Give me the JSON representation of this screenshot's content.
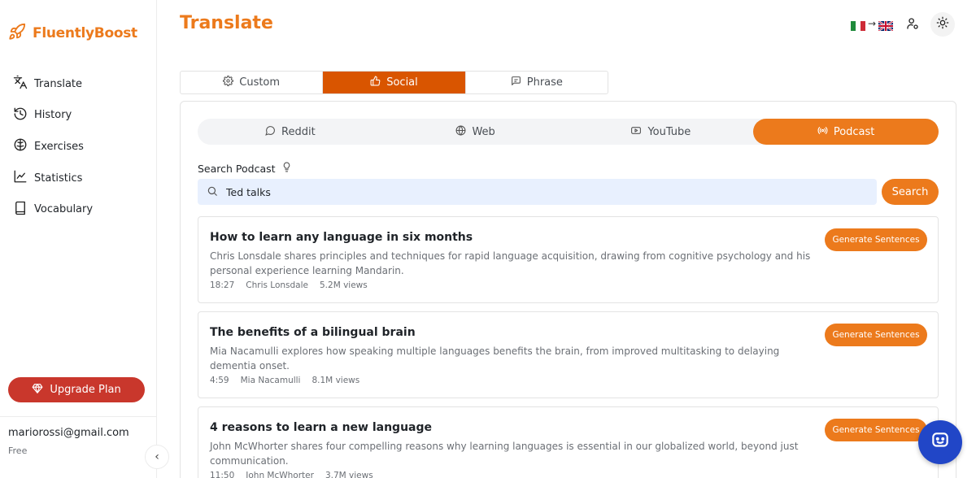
{
  "brand": {
    "name": "FluentlyBoost"
  },
  "sidebar": {
    "items": [
      {
        "label": "Translate",
        "icon": "translate-icon"
      },
      {
        "label": "History",
        "icon": "history-icon"
      },
      {
        "label": "Exercises",
        "icon": "brain-icon"
      },
      {
        "label": "Statistics",
        "icon": "chart-line-icon"
      },
      {
        "label": "Vocabulary",
        "icon": "book-icon"
      }
    ],
    "upgrade_label": "Upgrade Plan",
    "account": {
      "email": "mariorossi@gmail.com",
      "plan": "Free"
    }
  },
  "header": {
    "title": "Translate",
    "lang_from": "Italian",
    "lang_to": "English"
  },
  "top_tabs": [
    {
      "label": "Custom",
      "icon": "gear-icon",
      "active": false
    },
    {
      "label": "Social",
      "icon": "thumbs-up-icon",
      "active": true
    },
    {
      "label": "Phrase",
      "icon": "message-icon",
      "active": false
    }
  ],
  "source_tabs": [
    {
      "label": "Reddit",
      "icon": "chat-bubble-icon",
      "active": false
    },
    {
      "label": "Web",
      "icon": "globe-icon",
      "active": false
    },
    {
      "label": "YouTube",
      "icon": "youtube-icon",
      "active": false
    },
    {
      "label": "Podcast",
      "icon": "podcast-icon",
      "active": true
    }
  ],
  "search": {
    "label": "Search Podcast",
    "value": "Ted talks",
    "button_label": "Search"
  },
  "results": [
    {
      "title": "How to learn any language in six months",
      "description": "Chris Lonsdale shares principles and techniques for rapid language acquisition, drawing from cognitive psychology and his personal experience learning Mandarin.",
      "duration": "18:27",
      "author": "Chris Lonsdale",
      "views": "5.2M views",
      "button_label": "Generate Sentences"
    },
    {
      "title": "The benefits of a bilingual brain",
      "description": "Mia Nacamulli explores how speaking multiple languages benefits the brain, from improved multitasking to delaying dementia onset.",
      "duration": "4:59",
      "author": "Mia Nacamulli",
      "views": "8.1M views",
      "button_label": "Generate Sentences"
    },
    {
      "title": "4 reasons to learn a new language",
      "description": "John McWhorter shares four compelling reasons why learning languages is essential in our globalized world, beyond just communication.",
      "duration": "11:50",
      "author": "John McWhorter",
      "views": "3.7M views",
      "button_label": "Generate Sentences"
    }
  ],
  "colors": {
    "accent": "#ec7a1c",
    "active_tab": "#d95500",
    "upgrade": "#c9372c",
    "chat_fab": "#2146c7",
    "search_bg": "#e8f0fe"
  }
}
